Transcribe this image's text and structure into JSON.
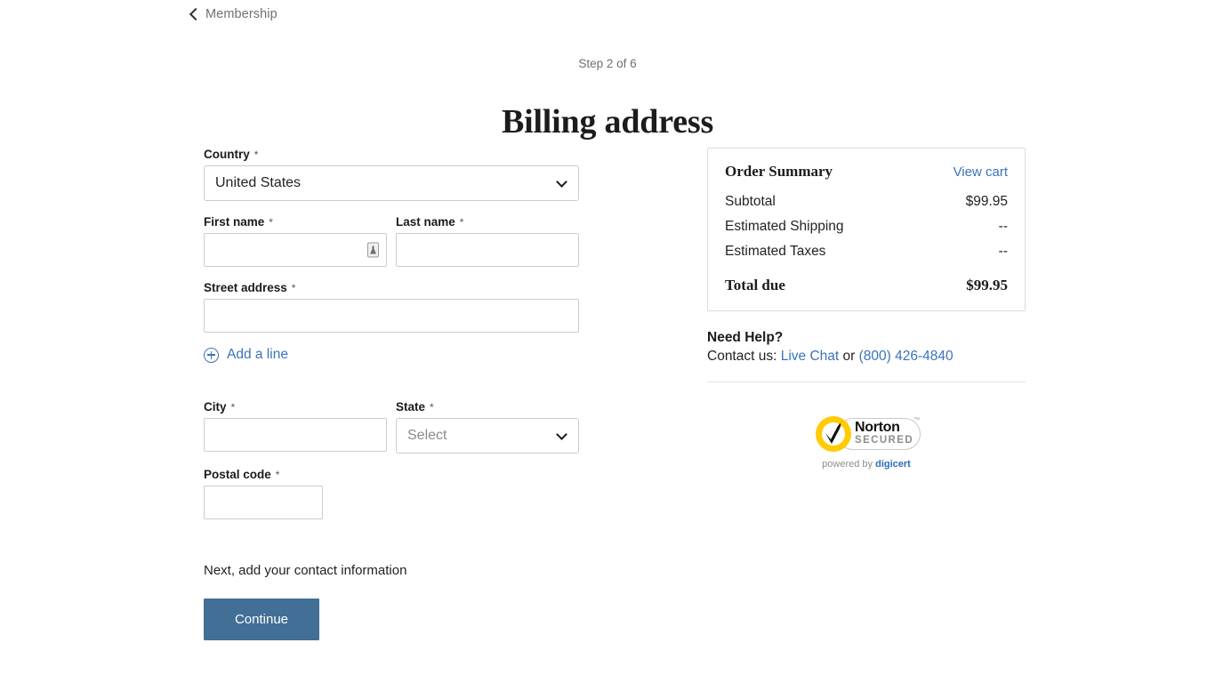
{
  "back": {
    "label": "Membership",
    "icon": "chevron-left-icon"
  },
  "header": {
    "step": "Step 2 of 6",
    "title": "Billing address"
  },
  "form": {
    "country": {
      "label": "Country",
      "required": "*",
      "value": "United States",
      "caret_icon": "chevron-down-icon"
    },
    "first_name": {
      "label": "First name",
      "required": "*",
      "value": "",
      "placeholder": "",
      "icon": "autofill-contact-icon"
    },
    "last_name": {
      "label": "Last name",
      "required": "*",
      "value": "",
      "placeholder": ""
    },
    "street_address": {
      "label": "Street address",
      "required": "*",
      "value": "",
      "placeholder": ""
    },
    "add_line": {
      "label": "Add a line",
      "icon": "plus-circle-icon"
    },
    "city": {
      "label": "City",
      "required": "*",
      "value": "",
      "placeholder": ""
    },
    "state": {
      "label": "State",
      "required": "*",
      "value": "Select",
      "caret_icon": "chevron-down-icon"
    },
    "postal_code": {
      "label": "Postal code",
      "required": "*",
      "value": "",
      "placeholder": ""
    },
    "next_note": "Next, add your contact information",
    "continue_label": "Continue"
  },
  "summary": {
    "title": "Order Summary",
    "view_cart": "View cart",
    "rows": [
      {
        "label": "Subtotal",
        "value": "$99.95"
      },
      {
        "label": "Estimated Shipping",
        "value": "--"
      },
      {
        "label": "Estimated Taxes",
        "value": "--"
      }
    ],
    "total_label": "Total due",
    "total_value": "$99.95"
  },
  "help": {
    "title": "Need Help?",
    "contact_prefix": "Contact us: ",
    "live_chat": "Live Chat",
    "separator": " or ",
    "phone": "(800) 426-4840"
  },
  "badge": {
    "name": "Norton",
    "secured": "SECURED",
    "tm": "™",
    "powered_prefix": "powered by ",
    "powered_brand": "digicert",
    "icon": "norton-secured-badge"
  },
  "colors": {
    "link": "#3b73b9",
    "button": "#426f96",
    "border": "#cccccc",
    "badge_yellow": "#ffcb05"
  }
}
